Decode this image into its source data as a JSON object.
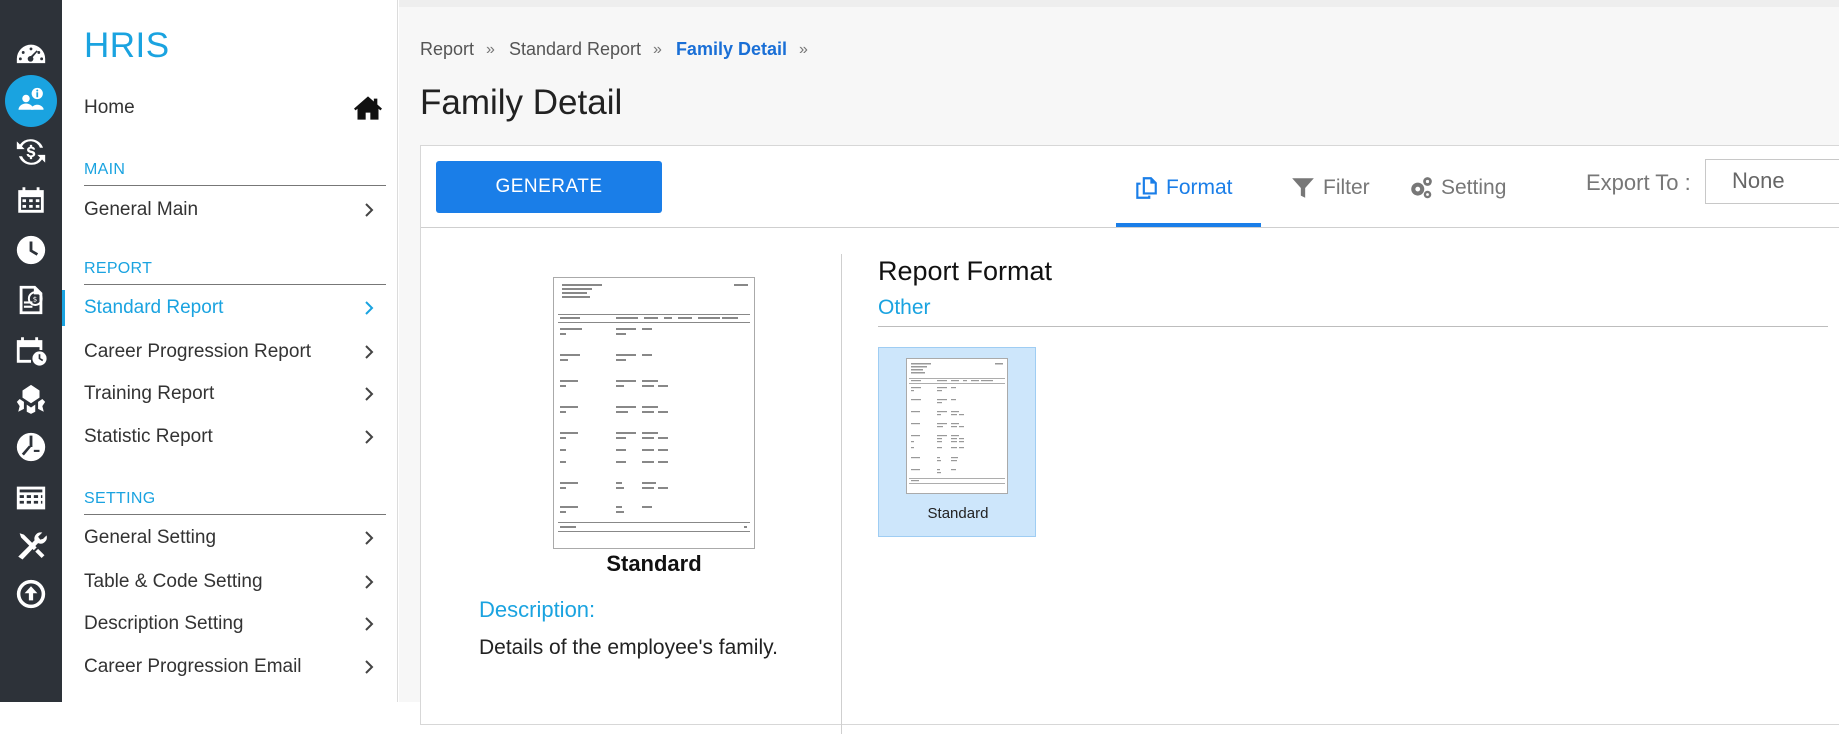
{
  "rail": {
    "icons": [
      "dashboard-icon",
      "people-info-icon",
      "money-cycle-icon",
      "calendar-icon",
      "clock-icon",
      "payslip-icon",
      "schedule-icon",
      "reward-icon",
      "time-chart-icon",
      "table-grid-icon",
      "tools-icon",
      "upload-icon"
    ],
    "active_index": 1,
    "accent": "#1aa3e0"
  },
  "sidebar": {
    "app_title": "HRIS",
    "home_label": "Home",
    "sections": {
      "main": "MAIN",
      "report": "REPORT",
      "setting": "SETTING"
    },
    "main_items": [
      "General Main"
    ],
    "report_items": [
      "Standard Report",
      "Career Progression Report",
      "Training Report",
      "Statistic Report"
    ],
    "setting_items": [
      "General Setting",
      "Table & Code Setting",
      "Description Setting",
      "Career Progression Email"
    ],
    "active_item": "Standard Report"
  },
  "breadcrumb": [
    "Report",
    "Standard Report",
    "Family Detail"
  ],
  "page_title": "Family Detail",
  "toolbar": {
    "generate_label": "GENERATE",
    "tabs": [
      "Format",
      "Filter",
      "Setting"
    ],
    "active_tab": "Format",
    "export_label": "Export To :",
    "export_value": "None"
  },
  "preview": {
    "title": "Standard",
    "description_label": "Description:",
    "description_text": "Details of the employee's family."
  },
  "report_format": {
    "title": "Report Format",
    "group": "Other",
    "cards": [
      {
        "label": "Standard",
        "selected": true
      }
    ]
  },
  "colors": {
    "primary_button": "#1a7ee8",
    "link_accent": "#1aa3e0",
    "rail_background": "#2d3239"
  }
}
